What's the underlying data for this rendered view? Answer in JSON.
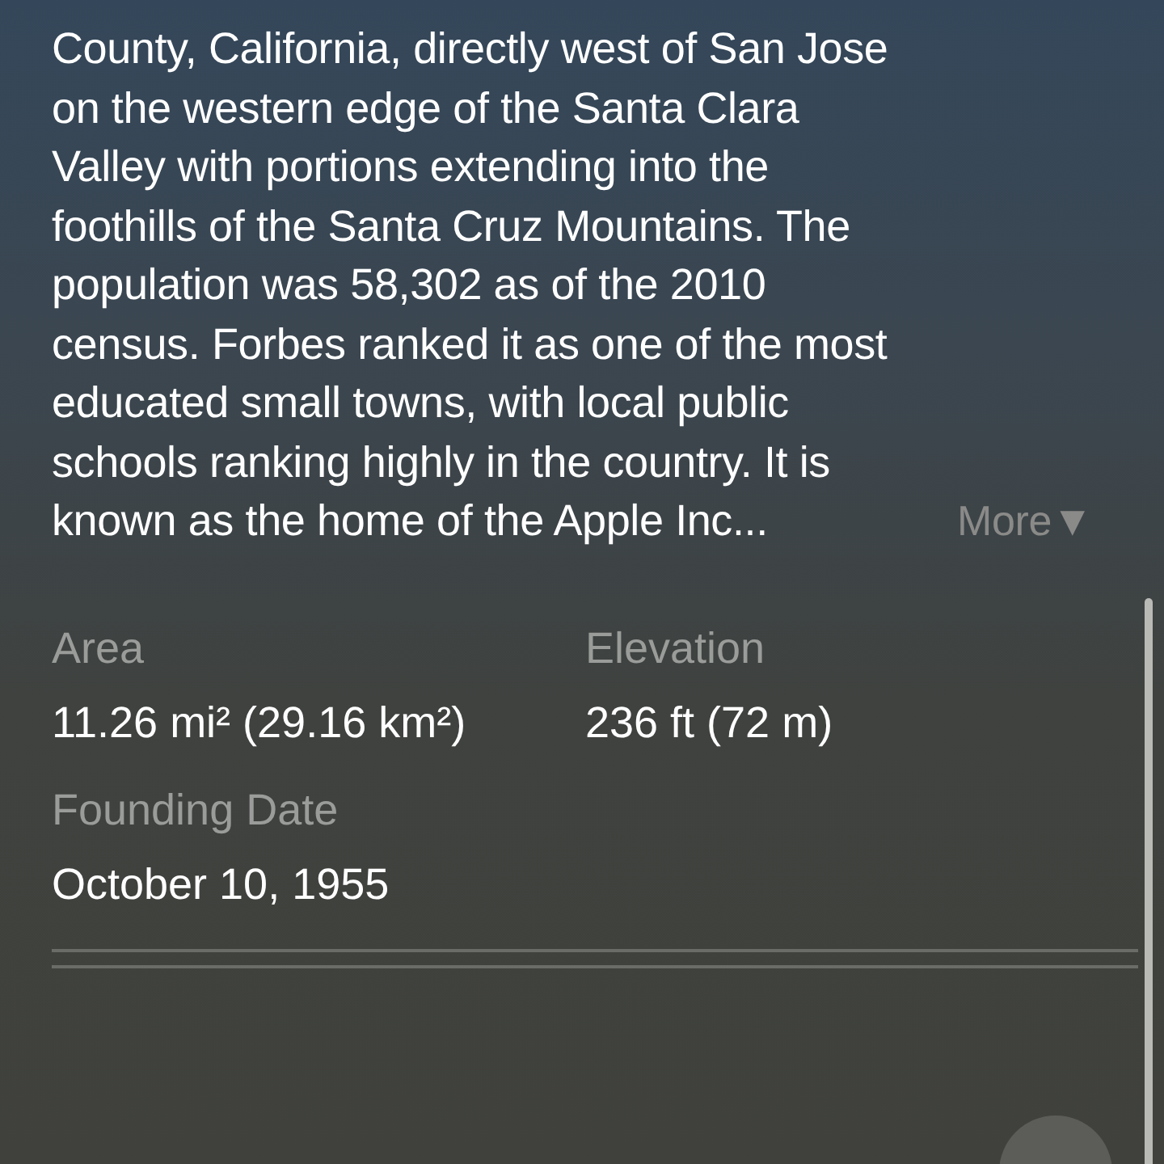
{
  "description": {
    "lines": [
      "County, California, directly west of San Jose",
      "on the western edge of the Santa Clara",
      "Valley with portions extending into the",
      "foothills of the Santa Cruz Mountains. The",
      "population was 58,302 as of the 2010",
      "census. Forbes ranked it as one of the most",
      "educated small towns, with local public",
      "schools ranking highly in the country. It is",
      "known as the home of the Apple Inc..."
    ],
    "more": "More▼"
  },
  "facts": [
    {
      "label": "Area",
      "value": "11.26 mi² (29.16 km²)"
    },
    {
      "label": "Elevation",
      "value": "236 ft (72 m)"
    },
    {
      "label": "Founding Date",
      "value": "October 10, 1955"
    }
  ]
}
